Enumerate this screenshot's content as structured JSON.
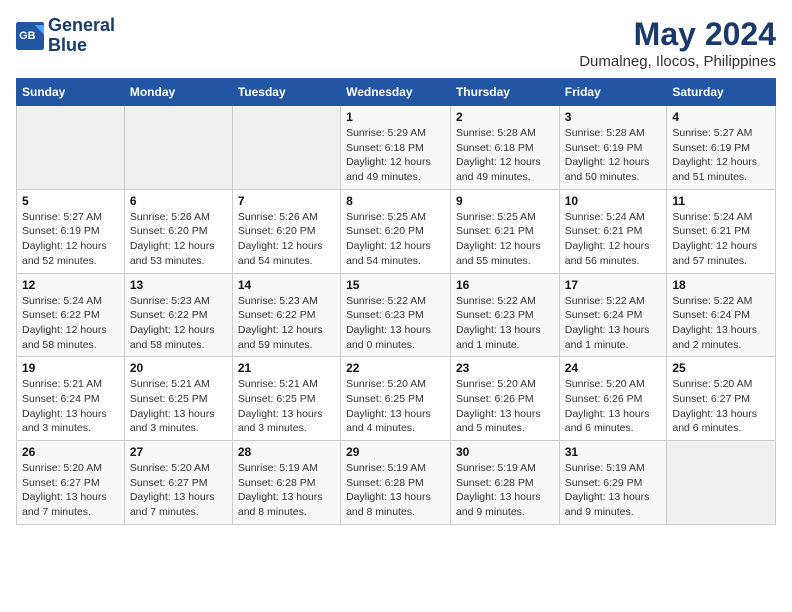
{
  "header": {
    "logo_line1": "General",
    "logo_line2": "Blue",
    "title": "May 2024",
    "subtitle": "Dumalneg, Ilocos, Philippines"
  },
  "weekdays": [
    "Sunday",
    "Monday",
    "Tuesday",
    "Wednesday",
    "Thursday",
    "Friday",
    "Saturday"
  ],
  "weeks": [
    [
      {
        "day": "",
        "info": ""
      },
      {
        "day": "",
        "info": ""
      },
      {
        "day": "",
        "info": ""
      },
      {
        "day": "1",
        "info": "Sunrise: 5:29 AM\nSunset: 6:18 PM\nDaylight: 12 hours\nand 49 minutes."
      },
      {
        "day": "2",
        "info": "Sunrise: 5:28 AM\nSunset: 6:18 PM\nDaylight: 12 hours\nand 49 minutes."
      },
      {
        "day": "3",
        "info": "Sunrise: 5:28 AM\nSunset: 6:19 PM\nDaylight: 12 hours\nand 50 minutes."
      },
      {
        "day": "4",
        "info": "Sunrise: 5:27 AM\nSunset: 6:19 PM\nDaylight: 12 hours\nand 51 minutes."
      }
    ],
    [
      {
        "day": "5",
        "info": "Sunrise: 5:27 AM\nSunset: 6:19 PM\nDaylight: 12 hours\nand 52 minutes."
      },
      {
        "day": "6",
        "info": "Sunrise: 5:26 AM\nSunset: 6:20 PM\nDaylight: 12 hours\nand 53 minutes."
      },
      {
        "day": "7",
        "info": "Sunrise: 5:26 AM\nSunset: 6:20 PM\nDaylight: 12 hours\nand 54 minutes."
      },
      {
        "day": "8",
        "info": "Sunrise: 5:25 AM\nSunset: 6:20 PM\nDaylight: 12 hours\nand 54 minutes."
      },
      {
        "day": "9",
        "info": "Sunrise: 5:25 AM\nSunset: 6:21 PM\nDaylight: 12 hours\nand 55 minutes."
      },
      {
        "day": "10",
        "info": "Sunrise: 5:24 AM\nSunset: 6:21 PM\nDaylight: 12 hours\nand 56 minutes."
      },
      {
        "day": "11",
        "info": "Sunrise: 5:24 AM\nSunset: 6:21 PM\nDaylight: 12 hours\nand 57 minutes."
      }
    ],
    [
      {
        "day": "12",
        "info": "Sunrise: 5:24 AM\nSunset: 6:22 PM\nDaylight: 12 hours\nand 58 minutes."
      },
      {
        "day": "13",
        "info": "Sunrise: 5:23 AM\nSunset: 6:22 PM\nDaylight: 12 hours\nand 58 minutes."
      },
      {
        "day": "14",
        "info": "Sunrise: 5:23 AM\nSunset: 6:22 PM\nDaylight: 12 hours\nand 59 minutes."
      },
      {
        "day": "15",
        "info": "Sunrise: 5:22 AM\nSunset: 6:23 PM\nDaylight: 13 hours\nand 0 minutes."
      },
      {
        "day": "16",
        "info": "Sunrise: 5:22 AM\nSunset: 6:23 PM\nDaylight: 13 hours\nand 1 minute."
      },
      {
        "day": "17",
        "info": "Sunrise: 5:22 AM\nSunset: 6:24 PM\nDaylight: 13 hours\nand 1 minute."
      },
      {
        "day": "18",
        "info": "Sunrise: 5:22 AM\nSunset: 6:24 PM\nDaylight: 13 hours\nand 2 minutes."
      }
    ],
    [
      {
        "day": "19",
        "info": "Sunrise: 5:21 AM\nSunset: 6:24 PM\nDaylight: 13 hours\nand 3 minutes."
      },
      {
        "day": "20",
        "info": "Sunrise: 5:21 AM\nSunset: 6:25 PM\nDaylight: 13 hours\nand 3 minutes."
      },
      {
        "day": "21",
        "info": "Sunrise: 5:21 AM\nSunset: 6:25 PM\nDaylight: 13 hours\nand 3 minutes."
      },
      {
        "day": "22",
        "info": "Sunrise: 5:20 AM\nSunset: 6:25 PM\nDaylight: 13 hours\nand 4 minutes."
      },
      {
        "day": "23",
        "info": "Sunrise: 5:20 AM\nSunset: 6:26 PM\nDaylight: 13 hours\nand 5 minutes."
      },
      {
        "day": "24",
        "info": "Sunrise: 5:20 AM\nSunset: 6:26 PM\nDaylight: 13 hours\nand 6 minutes."
      },
      {
        "day": "25",
        "info": "Sunrise: 5:20 AM\nSunset: 6:27 PM\nDaylight: 13 hours\nand 6 minutes."
      }
    ],
    [
      {
        "day": "26",
        "info": "Sunrise: 5:20 AM\nSunset: 6:27 PM\nDaylight: 13 hours\nand 7 minutes."
      },
      {
        "day": "27",
        "info": "Sunrise: 5:20 AM\nSunset: 6:27 PM\nDaylight: 13 hours\nand 7 minutes."
      },
      {
        "day": "28",
        "info": "Sunrise: 5:19 AM\nSunset: 6:28 PM\nDaylight: 13 hours\nand 8 minutes."
      },
      {
        "day": "29",
        "info": "Sunrise: 5:19 AM\nSunset: 6:28 PM\nDaylight: 13 hours\nand 8 minutes."
      },
      {
        "day": "30",
        "info": "Sunrise: 5:19 AM\nSunset: 6:28 PM\nDaylight: 13 hours\nand 9 minutes."
      },
      {
        "day": "31",
        "info": "Sunrise: 5:19 AM\nSunset: 6:29 PM\nDaylight: 13 hours\nand 9 minutes."
      },
      {
        "day": "",
        "info": ""
      }
    ]
  ]
}
